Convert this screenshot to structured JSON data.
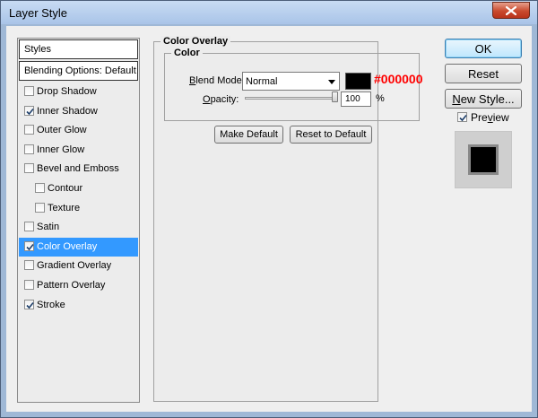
{
  "window": {
    "title": "Layer Style"
  },
  "left": {
    "styles_header": "Styles",
    "blending_header": "Blending Options: Default",
    "items": [
      {
        "label": "Drop Shadow",
        "checked": false,
        "indent": false,
        "selected": false
      },
      {
        "label": "Inner Shadow",
        "checked": true,
        "indent": false,
        "selected": false
      },
      {
        "label": "Outer Glow",
        "checked": false,
        "indent": false,
        "selected": false
      },
      {
        "label": "Inner Glow",
        "checked": false,
        "indent": false,
        "selected": false
      },
      {
        "label": "Bevel and Emboss",
        "checked": false,
        "indent": false,
        "selected": false
      },
      {
        "label": "Contour",
        "checked": false,
        "indent": true,
        "selected": false
      },
      {
        "label": "Texture",
        "checked": false,
        "indent": true,
        "selected": false
      },
      {
        "label": "Satin",
        "checked": false,
        "indent": false,
        "selected": false
      },
      {
        "label": "Color Overlay",
        "checked": true,
        "indent": false,
        "selected": true
      },
      {
        "label": "Gradient Overlay",
        "checked": false,
        "indent": false,
        "selected": false
      },
      {
        "label": "Pattern Overlay",
        "checked": false,
        "indent": false,
        "selected": false
      },
      {
        "label": "Stroke",
        "checked": true,
        "indent": false,
        "selected": false
      }
    ]
  },
  "overlay": {
    "group_title": "Color Overlay",
    "subgroup_title": "Color",
    "blend_mode_label_pre": "",
    "blend_mode_label_u": "B",
    "blend_mode_label_post": "lend Mode:",
    "blend_mode_value": "Normal",
    "color_hex": "#000000",
    "color_annotation": "#000000",
    "opacity_label_pre": "",
    "opacity_label_u": "O",
    "opacity_label_post": "pacity:",
    "opacity_value": "100",
    "opacity_unit": "%",
    "opacity_level": 1.0,
    "make_default": "Make Default",
    "reset_default": "Reset to Default"
  },
  "buttons": {
    "ok": "OK",
    "reset": "Reset",
    "new_style_u": "N",
    "new_style_rest": "ew Style...",
    "preview_pre": "Pre",
    "preview_u": "v",
    "preview_post": "iew",
    "preview_checked": true
  },
  "colors": {
    "selected_row": "#3399ff",
    "annotation": "#ff0000"
  }
}
